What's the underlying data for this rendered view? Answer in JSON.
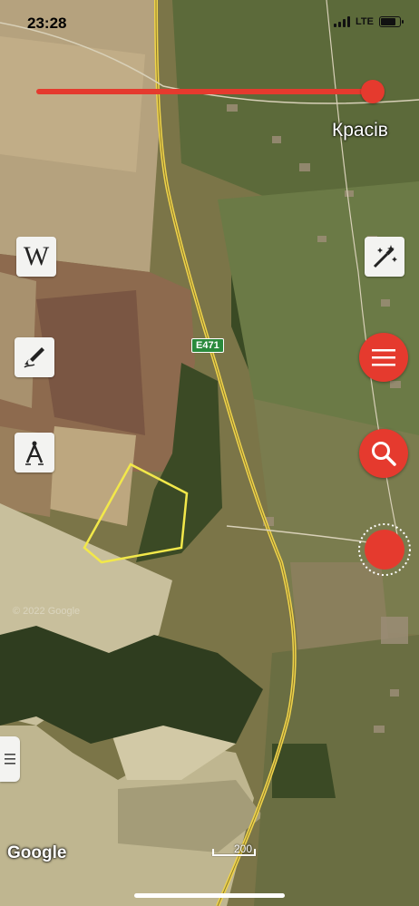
{
  "status_bar": {
    "time": "23:28",
    "network": "LTE"
  },
  "map": {
    "place_label": "Красів",
    "road_shield": "E471",
    "watermark": "© 2022 Google",
    "google_logo": "Google",
    "scale_label": "200",
    "colors": {
      "field_selection_outline": "#f2e84a",
      "accent_red": "#e53a2e",
      "road_yellow": "#f0d44a"
    }
  },
  "tools": {
    "wikipedia_label": "W"
  },
  "buttons": {
    "menu": "hamburger-icon",
    "search": "search-icon",
    "location": "location-target-icon"
  }
}
